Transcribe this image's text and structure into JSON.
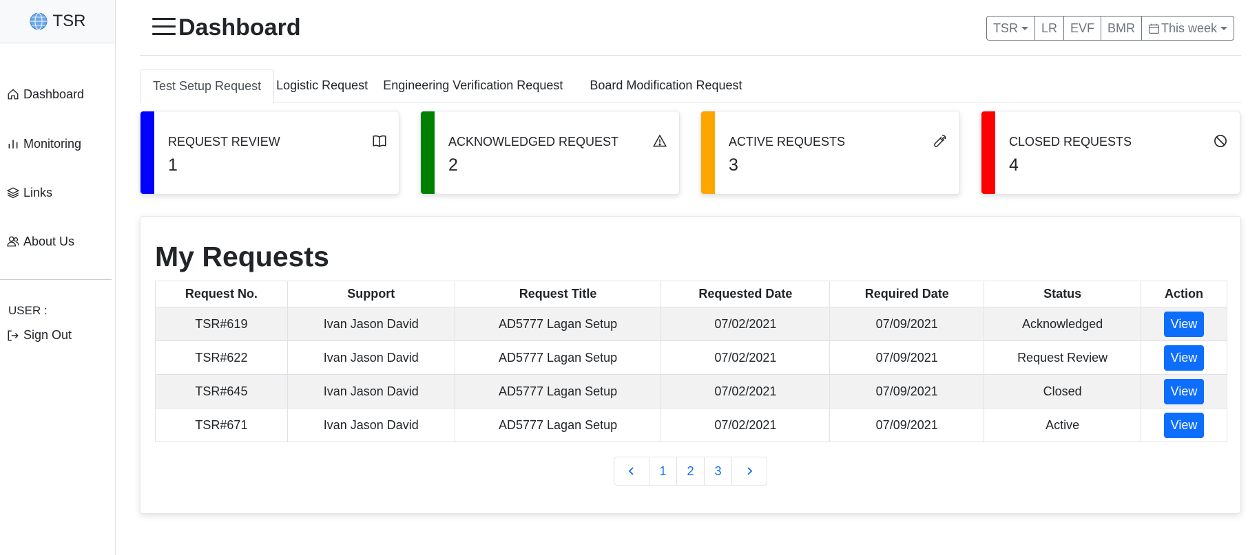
{
  "sidebar": {
    "brand": "TSR",
    "nav": [
      {
        "label": "Dashboard",
        "icon": "home-icon"
      },
      {
        "label": "Monitoring",
        "icon": "bar-chart-icon"
      },
      {
        "label": "Links",
        "icon": "layers-icon"
      },
      {
        "label": "About Us",
        "icon": "people-icon"
      }
    ],
    "user_label": "USER :",
    "sign_out": "Sign Out"
  },
  "header": {
    "title": "Dashboard",
    "buttons": {
      "tsr": "TSR",
      "lr": "LR",
      "evf": "EVF",
      "bmr": "BMR",
      "period": "This week"
    }
  },
  "tabs": [
    {
      "label": "Test Setup Request",
      "active": true
    },
    {
      "label": "Logistic Request",
      "active": false
    },
    {
      "label": "Engineering Verification Request",
      "active": false
    },
    {
      "label": "Board Modification Request",
      "active": false
    }
  ],
  "cards": [
    {
      "label": "REQUEST REVIEW",
      "value": "1",
      "color": "#0000ff",
      "icon": "book-icon"
    },
    {
      "label": "ACKNOWLEDGED REQUEST",
      "value": "2",
      "color": "#008000",
      "icon": "warning-icon"
    },
    {
      "label": "ACTIVE REQUESTS",
      "value": "3",
      "color": "#ffa500",
      "icon": "wrench-icon"
    },
    {
      "label": "CLOSED REQUESTS",
      "value": "4",
      "color": "#ff0000",
      "icon": "ban-icon"
    }
  ],
  "requests": {
    "title": "My Requests",
    "columns": [
      "Request No.",
      "Support",
      "Request Title",
      "Requested Date",
      "Required Date",
      "Status",
      "Action"
    ],
    "rows": [
      {
        "no": "TSR#619",
        "support": "Ivan Jason David",
        "title": "AD5777 Lagan Setup",
        "requested": "07/02/2021",
        "required": "07/09/2021",
        "status": "Acknowledged",
        "action": "View"
      },
      {
        "no": "TSR#622",
        "support": "Ivan Jason David",
        "title": "AD5777 Lagan Setup",
        "requested": "07/02/2021",
        "required": "07/09/2021",
        "status": "Request Review",
        "action": "View"
      },
      {
        "no": "TSR#645",
        "support": "Ivan Jason David",
        "title": "AD5777 Lagan Setup",
        "requested": "07/02/2021",
        "required": "07/09/2021",
        "status": "Closed",
        "action": "View"
      },
      {
        "no": "TSR#671",
        "support": "Ivan Jason David",
        "title": "AD5777 Lagan Setup",
        "requested": "07/02/2021",
        "required": "07/09/2021",
        "status": "Active",
        "action": "View"
      }
    ],
    "pages": [
      "1",
      "2",
      "3"
    ]
  },
  "colors": {
    "primary": "#0d6efd",
    "secondary": "#6c757d"
  }
}
